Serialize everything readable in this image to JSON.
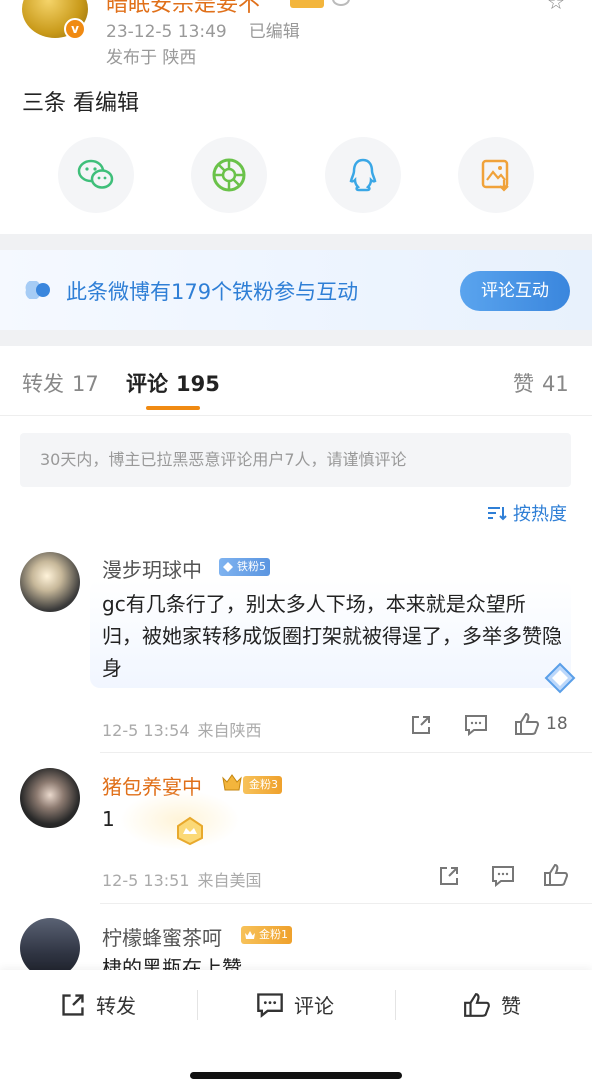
{
  "post": {
    "author": "暗眠安宗是妄不",
    "time": "23-12-5 13:49",
    "edited": "已编辑",
    "location": "发布于 陕西",
    "text": "三条 看编辑"
  },
  "share": {
    "icons": [
      "wechat-icon",
      "moments-icon",
      "qq-icon",
      "save-image-icon"
    ]
  },
  "fan_banner": {
    "text": "此条微博有179个铁粉参与互动",
    "button": "评论互动"
  },
  "tabs": [
    {
      "label": "转发",
      "count": "17"
    },
    {
      "label": "评论",
      "count": "195"
    },
    {
      "label": "赞",
      "count": "41"
    }
  ],
  "notice": "30天内，博主已拉黑恶意评论用户7人，请谨慎评论",
  "sort_label": "按热度",
  "comments": [
    {
      "name": "漫步玥球中",
      "badge": "铁粉5",
      "text": "gc有几条行了，别太多人下场，本来就是众望所归，被她家转移成饭圈打架就被得逞了，多举多赞隐身",
      "time": "12-5 13:54",
      "source": "来自陕西",
      "likes": "18"
    },
    {
      "name": "猪包养宴中",
      "badge": "金粉3",
      "text": "1",
      "time": "12-5 13:51",
      "source": "来自美国",
      "likes": ""
    },
    {
      "name": "柠檬蜂蜜茶呵",
      "badge": "金粉1",
      "text": "棣的黑瓶在上赞",
      "time": "",
      "source": "",
      "likes": ""
    }
  ],
  "bottom_bar": {
    "repost": "转发",
    "comment": "评论",
    "like": "赞"
  },
  "colors": {
    "accent_orange": "#f08a12",
    "link_blue": "#2f7fd6",
    "gold_name": "#e0701a"
  }
}
